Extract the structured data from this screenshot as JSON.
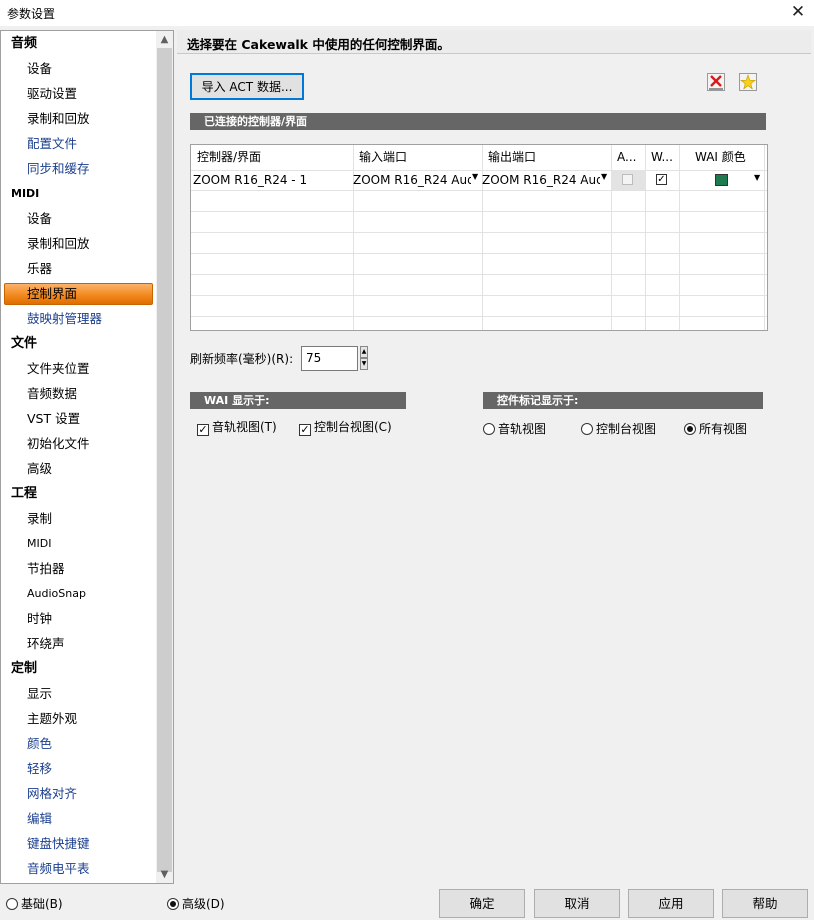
{
  "window": {
    "title": "参数设置",
    "close_glyph": "✕"
  },
  "sidebar": {
    "items": [
      {
        "kind": "cat",
        "label": "音频"
      },
      {
        "kind": "sub",
        "label": "设备"
      },
      {
        "kind": "sub",
        "label": "驱动设置"
      },
      {
        "kind": "sub",
        "label": "录制和回放"
      },
      {
        "kind": "sub link",
        "label": "配置文件"
      },
      {
        "kind": "sub link",
        "label": "同步和缓存"
      },
      {
        "kind": "cat small",
        "label": "MIDI"
      },
      {
        "kind": "sub",
        "label": "设备"
      },
      {
        "kind": "sub",
        "label": "录制和回放"
      },
      {
        "kind": "sub",
        "label": "乐器"
      },
      {
        "kind": "sub selected",
        "label": "控制界面"
      },
      {
        "kind": "sub link",
        "label": "鼓映射管理器"
      },
      {
        "kind": "cat",
        "label": "文件"
      },
      {
        "kind": "sub",
        "label": "文件夹位置"
      },
      {
        "kind": "sub",
        "label": "音频数据"
      },
      {
        "kind": "sub",
        "label": "VST 设置"
      },
      {
        "kind": "sub",
        "label": "初始化文件"
      },
      {
        "kind": "sub",
        "label": "高级"
      },
      {
        "kind": "cat",
        "label": "工程"
      },
      {
        "kind": "sub",
        "label": "录制"
      },
      {
        "kind": "sub small",
        "label": "MIDI"
      },
      {
        "kind": "sub",
        "label": "节拍器"
      },
      {
        "kind": "sub small",
        "label": "AudioSnap"
      },
      {
        "kind": "sub",
        "label": "时钟"
      },
      {
        "kind": "sub",
        "label": "环绕声"
      },
      {
        "kind": "cat",
        "label": "定制"
      },
      {
        "kind": "sub",
        "label": "显示"
      },
      {
        "kind": "sub",
        "label": "主题外观"
      },
      {
        "kind": "sub link",
        "label": "颜色"
      },
      {
        "kind": "sub link",
        "label": "轻移"
      },
      {
        "kind": "sub link",
        "label": "网格对齐"
      },
      {
        "kind": "sub link",
        "label": "编辑"
      },
      {
        "kind": "sub link",
        "label": "键盘快捷键"
      },
      {
        "kind": "sub link",
        "label": "音频电平表"
      }
    ],
    "selected_label": "控制界面"
  },
  "main": {
    "header": "选择要在 Cakewalk 中使用的任何控制界面。",
    "import_button": "导入 ACT 数据...",
    "connected_section": "已连接的控制器/界面",
    "grid": {
      "columns": [
        "控制器/界面",
        "输入端口",
        "输出端口",
        "A...",
        "W...",
        "WAI 颜色"
      ],
      "rows": [
        {
          "controller": "ZOOM R16_R24 - 1",
          "input": "ZOOM R16_R24 Aud",
          "output": "ZOOM R16_R24 Aud",
          "act_enabled": false,
          "wai_enabled": true,
          "wai_color": "#1e7a4f"
        }
      ]
    },
    "refresh_label": "刷新频率(毫秒)(R):",
    "refresh_value": "75",
    "wai_section": "WAI 显示于:",
    "wai_options": [
      {
        "label": "音轨视图(T)",
        "checked": true
      },
      {
        "label": "控制台视图(C)",
        "checked": true
      }
    ],
    "markers_section": "控件标记显示于:",
    "marker_options": [
      {
        "label": "音轨视图",
        "selected": false
      },
      {
        "label": "控制台视图",
        "selected": false
      },
      {
        "label": "所有视图",
        "selected": true
      }
    ]
  },
  "footer": {
    "mode_basic": "基础(B)",
    "mode_advanced": "高级(D)",
    "mode_selected": "advanced",
    "ok": "确定",
    "cancel": "取消",
    "apply": "应用",
    "help": "帮助"
  },
  "colors": {
    "selection_orange": "#f28a1f",
    "section_bar": "#666666",
    "link_blue": "#1c3f8f",
    "focus_blue": "#0078d7"
  }
}
